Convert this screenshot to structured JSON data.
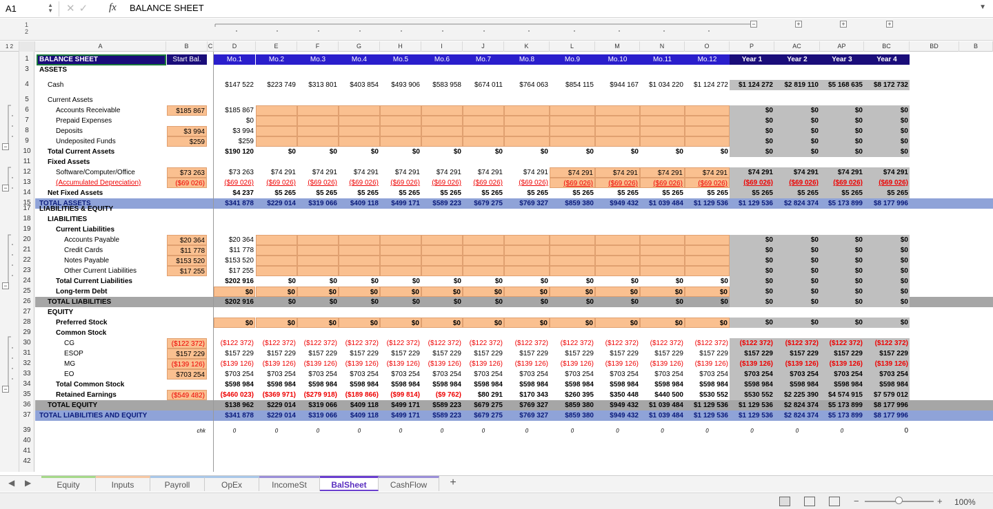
{
  "formula_bar": {
    "cell_ref": "A1",
    "fx": "fx",
    "formula": "BALANCE SHEET"
  },
  "outline_levels": {
    "top": [
      "1",
      "2"
    ],
    "left": [
      "1",
      "2"
    ]
  },
  "columns": [
    "A",
    "B",
    "C",
    "D",
    "E",
    "F",
    "G",
    "H",
    "I",
    "J",
    "K",
    "L",
    "M",
    "N",
    "O",
    "P",
    "AC",
    "AP",
    "BC",
    "BD",
    "B"
  ],
  "header_row": {
    "title": "BALANCE SHEET",
    "start": "Start Bal.",
    "periods": [
      "Mo.1",
      "Mo.2",
      "Mo.3",
      "Mo.4",
      "Mo.5",
      "Mo.6",
      "Mo.7",
      "Mo.8",
      "Mo.9",
      "Mo.10",
      "Mo.11",
      "Mo.12",
      "Year 1",
      "Year 2",
      "Year 3",
      "Year 4"
    ]
  },
  "rows": [
    {
      "n": "3",
      "label": "ASSETS",
      "indent": 0,
      "bold": true
    },
    {
      "n": "4",
      "label": "Cash",
      "indent": 1,
      "start": "",
      "vals": [
        "$147 522",
        "$223 749",
        "$313 801",
        "$403 854",
        "$493 906",
        "$583 958",
        "$674 011",
        "$764 063",
        "$854 115",
        "$944 167",
        "$1 034 220",
        "$1 124 272",
        "$1 124 272",
        "$2 819 110",
        "$5 168 635",
        "$8 172 732"
      ]
    },
    {
      "n": "5",
      "label": "Current Assets",
      "indent": 1
    },
    {
      "n": "6",
      "label": "Accounts Receivable",
      "indent": 2,
      "start": "$185 867",
      "vals": [
        "$185 867",
        "",
        "",
        "",
        "",
        "",
        "",
        "",
        "",
        "",
        "",
        "",
        "$0",
        "$0",
        "$0",
        "$0"
      ]
    },
    {
      "n": "7",
      "label": "Prepaid Expenses",
      "indent": 2,
      "start": "",
      "vals": [
        "$0",
        "",
        "",
        "",
        "",
        "",
        "",
        "",
        "",
        "",
        "",
        "",
        "$0",
        "$0",
        "$0",
        "$0"
      ]
    },
    {
      "n": "8",
      "label": "Deposits",
      "indent": 2,
      "start": "$3 994",
      "vals": [
        "$3 994",
        "",
        "",
        "",
        "",
        "",
        "",
        "",
        "",
        "",
        "",
        "",
        "$0",
        "$0",
        "$0",
        "$0"
      ]
    },
    {
      "n": "9",
      "label": "Undeposited Funds",
      "indent": 2,
      "start": "$259",
      "vals": [
        "$259",
        "",
        "",
        "",
        "",
        "",
        "",
        "",
        "",
        "",
        "",
        "",
        "$0",
        "$0",
        "$0",
        "$0"
      ]
    },
    {
      "n": "10",
      "label": "Total Current Assets",
      "indent": 1,
      "bold": true,
      "start": "",
      "vals": [
        "$190 120",
        "$0",
        "$0",
        "$0",
        "$0",
        "$0",
        "$0",
        "$0",
        "$0",
        "$0",
        "$0",
        "$0",
        "$0",
        "$0",
        "$0",
        "$0"
      ]
    },
    {
      "n": "11",
      "label": "Fixed Assets",
      "indent": 1,
      "bold": true
    },
    {
      "n": "12",
      "label": "Software/Computer/Office",
      "indent": 2,
      "start": "$73 263",
      "vals": [
        "$73 263",
        "$74 291",
        "$74 291",
        "$74 291",
        "$74 291",
        "$74 291",
        "$74 291",
        "$74 291",
        "$74 291",
        "$74 291",
        "$74 291",
        "$74 291",
        "$74 291",
        "$74 291",
        "$74 291",
        "$74 291"
      ]
    },
    {
      "n": "13",
      "label": "(Accumulated Depreciation)",
      "indent": 2,
      "neg": true,
      "start": "($69 026)",
      "vals": [
        "($69 026)",
        "($69 026)",
        "($69 026)",
        "($69 026)",
        "($69 026)",
        "($69 026)",
        "($69 026)",
        "($69 026)",
        "($69 026)",
        "($69 026)",
        "($69 026)",
        "($69 026)",
        "($69 026)",
        "($69 026)",
        "($69 026)",
        "($69 026)"
      ]
    },
    {
      "n": "14",
      "label": "Net Fixed Assets",
      "indent": 1,
      "bold": true,
      "start": "",
      "vals": [
        "$4 237",
        "$5 265",
        "$5 265",
        "$5 265",
        "$5 265",
        "$5 265",
        "$5 265",
        "$5 265",
        "$5 265",
        "$5 265",
        "$5 265",
        "$5 265",
        "$5 265",
        "$5 265",
        "$5 265",
        "$5 265"
      ]
    },
    {
      "n": "15",
      "label": "TOTAL ASSETS",
      "indent": 0,
      "bold": true,
      "total": true,
      "start": "",
      "vals": [
        "$341 878",
        "$229 014",
        "$319 066",
        "$409 118",
        "$499 171",
        "$589 223",
        "$679 275",
        "$769 327",
        "$859 380",
        "$949 432",
        "$1 039 484",
        "$1 129 536",
        "$1 129 536",
        "$2 824 374",
        "$5 173 899",
        "$8 177 996"
      ]
    },
    {
      "n": "17",
      "label": "LIABILITIES & EQUITY",
      "indent": 0,
      "bold": true
    },
    {
      "n": "18",
      "label": "LIABILITIES",
      "indent": 1,
      "bold": true
    },
    {
      "n": "19",
      "label": "Current Liabilities",
      "indent": 2,
      "bold": true
    },
    {
      "n": "20",
      "label": "Accounts Payable",
      "indent": 3,
      "start": "$20 364",
      "vals": [
        "$20 364",
        "",
        "",
        "",
        "",
        "",
        "",
        "",
        "",
        "",
        "",
        "",
        "$0",
        "$0",
        "$0",
        "$0"
      ]
    },
    {
      "n": "21",
      "label": "Credit Cards",
      "indent": 3,
      "start": "$11 778",
      "vals": [
        "$11 778",
        "",
        "",
        "",
        "",
        "",
        "",
        "",
        "",
        "",
        "",
        "",
        "$0",
        "$0",
        "$0",
        "$0"
      ]
    },
    {
      "n": "22",
      "label": "Notes Payable",
      "indent": 3,
      "start": "$153 520",
      "vals": [
        "$153 520",
        "",
        "",
        "",
        "",
        "",
        "",
        "",
        "",
        "",
        "",
        "",
        "$0",
        "$0",
        "$0",
        "$0"
      ]
    },
    {
      "n": "23",
      "label": "Other Current Liabilities",
      "indent": 3,
      "start": "$17 255",
      "vals": [
        "$17 255",
        "",
        "",
        "",
        "",
        "",
        "",
        "",
        "",
        "",
        "",
        "",
        "$0",
        "$0",
        "$0",
        "$0"
      ]
    },
    {
      "n": "24",
      "label": "Total Current Liabilities",
      "indent": 2,
      "bold": true,
      "start": "",
      "vals": [
        "$202 916",
        "$0",
        "$0",
        "$0",
        "$0",
        "$0",
        "$0",
        "$0",
        "$0",
        "$0",
        "$0",
        "$0",
        "$0",
        "$0",
        "$0",
        "$0"
      ]
    },
    {
      "n": "25",
      "label": "Long-term Debt",
      "indent": 2,
      "bold": true,
      "start": "",
      "vals": [
        "$0",
        "$0",
        "$0",
        "$0",
        "$0",
        "$0",
        "$0",
        "$0",
        "$0",
        "$0",
        "$0",
        "$0",
        "$0",
        "$0",
        "$0",
        "$0"
      ]
    },
    {
      "n": "26",
      "label": "TOTAL LIABILITIES",
      "indent": 1,
      "bold": true,
      "gtotal": true,
      "start": "",
      "vals": [
        "$202 916",
        "$0",
        "$0",
        "$0",
        "$0",
        "$0",
        "$0",
        "$0",
        "$0",
        "$0",
        "$0",
        "$0",
        "$0",
        "$0",
        "$0",
        "$0"
      ]
    },
    {
      "n": "27",
      "label": "EQUITY",
      "indent": 1,
      "bold": true
    },
    {
      "n": "28",
      "label": "Preferred Stock",
      "indent": 2,
      "bold": true,
      "start": "",
      "vals": [
        "$0",
        "$0",
        "$0",
        "$0",
        "$0",
        "$0",
        "$0",
        "$0",
        "$0",
        "$0",
        "$0",
        "$0",
        "$0",
        "$0",
        "$0",
        "$0"
      ]
    },
    {
      "n": "29",
      "label": "Common Stock",
      "indent": 2,
      "bold": true
    },
    {
      "n": "30",
      "label": "CG",
      "indent": 3,
      "start": "($122 372)",
      "vals": [
        "($122 372)",
        "($122 372)",
        "($122 372)",
        "($122 372)",
        "($122 372)",
        "($122 372)",
        "($122 372)",
        "($122 372)",
        "($122 372)",
        "($122 372)",
        "($122 372)",
        "($122 372)",
        "($122 372)",
        "($122 372)",
        "($122 372)",
        "($122 372)"
      ]
    },
    {
      "n": "31",
      "label": "ESOP",
      "indent": 3,
      "start": "$157 229",
      "vals": [
        "$157 229",
        "$157 229",
        "$157 229",
        "$157 229",
        "$157 229",
        "$157 229",
        "$157 229",
        "$157 229",
        "$157 229",
        "$157 229",
        "$157 229",
        "$157 229",
        "$157 229",
        "$157 229",
        "$157 229",
        "$157 229"
      ]
    },
    {
      "n": "32",
      "label": "MG",
      "indent": 3,
      "start": "($139 126)",
      "vals": [
        "($139 126)",
        "($139 126)",
        "($139 126)",
        "($139 126)",
        "($139 126)",
        "($139 126)",
        "($139 126)",
        "($139 126)",
        "($139 126)",
        "($139 126)",
        "($139 126)",
        "($139 126)",
        "($139 126)",
        "($139 126)",
        "($139 126)",
        "($139 126)"
      ]
    },
    {
      "n": "33",
      "label": "EO",
      "indent": 3,
      "start": "$703 254",
      "vals": [
        "$703 254",
        "$703 254",
        "$703 254",
        "$703 254",
        "$703 254",
        "$703 254",
        "$703 254",
        "$703 254",
        "$703 254",
        "$703 254",
        "$703 254",
        "$703 254",
        "$703 254",
        "$703 254",
        "$703 254",
        "$703 254"
      ]
    },
    {
      "n": "34",
      "label": "Total Common Stock",
      "indent": 2,
      "bold": true,
      "start": "",
      "vals": [
        "$598 984",
        "$598 984",
        "$598 984",
        "$598 984",
        "$598 984",
        "$598 984",
        "$598 984",
        "$598 984",
        "$598 984",
        "$598 984",
        "$598 984",
        "$598 984",
        "$598 984",
        "$598 984",
        "$598 984",
        "$598 984"
      ]
    },
    {
      "n": "35",
      "label": "Retained Earnings",
      "indent": 2,
      "bold": true,
      "start": "($549 482)",
      "vals": [
        "($460 023)",
        "($369 971)",
        "($279 918)",
        "($189 866)",
        "($99 814)",
        "($9 762)",
        "$80 291",
        "$170 343",
        "$260 395",
        "$350 448",
        "$440 500",
        "$530 552",
        "$530 552",
        "$2 225 390",
        "$4 574 915",
        "$7 579 012"
      ]
    },
    {
      "n": "36",
      "label": "TOTAL EQUITY",
      "indent": 1,
      "bold": true,
      "gtotal": true,
      "start": "",
      "vals": [
        "$138 962",
        "$229 014",
        "$319 066",
        "$409 118",
        "$499 171",
        "$589 223",
        "$679 275",
        "$769 327",
        "$859 380",
        "$949 432",
        "$1 039 484",
        "$1 129 536",
        "$1 129 536",
        "$2 824 374",
        "$5 173 899",
        "$8 177 996"
      ]
    },
    {
      "n": "37",
      "label": "TOTAL LIABILITIES AND EQUITY",
      "indent": 0,
      "bold": true,
      "total": true,
      "start": "",
      "vals": [
        "$341 878",
        "$229 014",
        "$319 066",
        "$409 118",
        "$499 171",
        "$589 223",
        "$679 275",
        "$769 327",
        "$859 380",
        "$949 432",
        "$1 039 484",
        "$1 129 536",
        "$1 129 536",
        "$2 824 374",
        "$5 173 899",
        "$8 177 996"
      ]
    },
    {
      "n": "39",
      "label": "",
      "indent": 0,
      "chk": true,
      "start": "chk",
      "vals": [
        "0",
        "0",
        "0",
        "0",
        "0",
        "0",
        "0",
        "0",
        "0",
        "0",
        "0",
        "0",
        "0",
        "0",
        "0",
        "0"
      ]
    },
    {
      "n": "40",
      "label": ""
    },
    {
      "n": "41",
      "label": ""
    },
    {
      "n": "42",
      "label": ""
    }
  ],
  "sheet_tabs": [
    {
      "label": "Equity",
      "color": "#a6d98a",
      "active": false
    },
    {
      "label": "Inputs",
      "color": "#f6c7a3",
      "active": false
    },
    {
      "label": "Payroll",
      "color": "#a9c7e8",
      "active": false
    },
    {
      "label": "OpEx",
      "color": "#a9c7e8",
      "active": false
    },
    {
      "label": "IncomeSt",
      "color": "#9b8fd8",
      "active": false
    },
    {
      "label": "BalSheet",
      "color": "#6a3fcf",
      "active": true
    },
    {
      "label": "CashFlow",
      "color": "#9b8fd8",
      "active": false
    }
  ],
  "add_sheet": "+",
  "zoom": "100%",
  "zoom_minus": "−",
  "zoom_plus": "+"
}
